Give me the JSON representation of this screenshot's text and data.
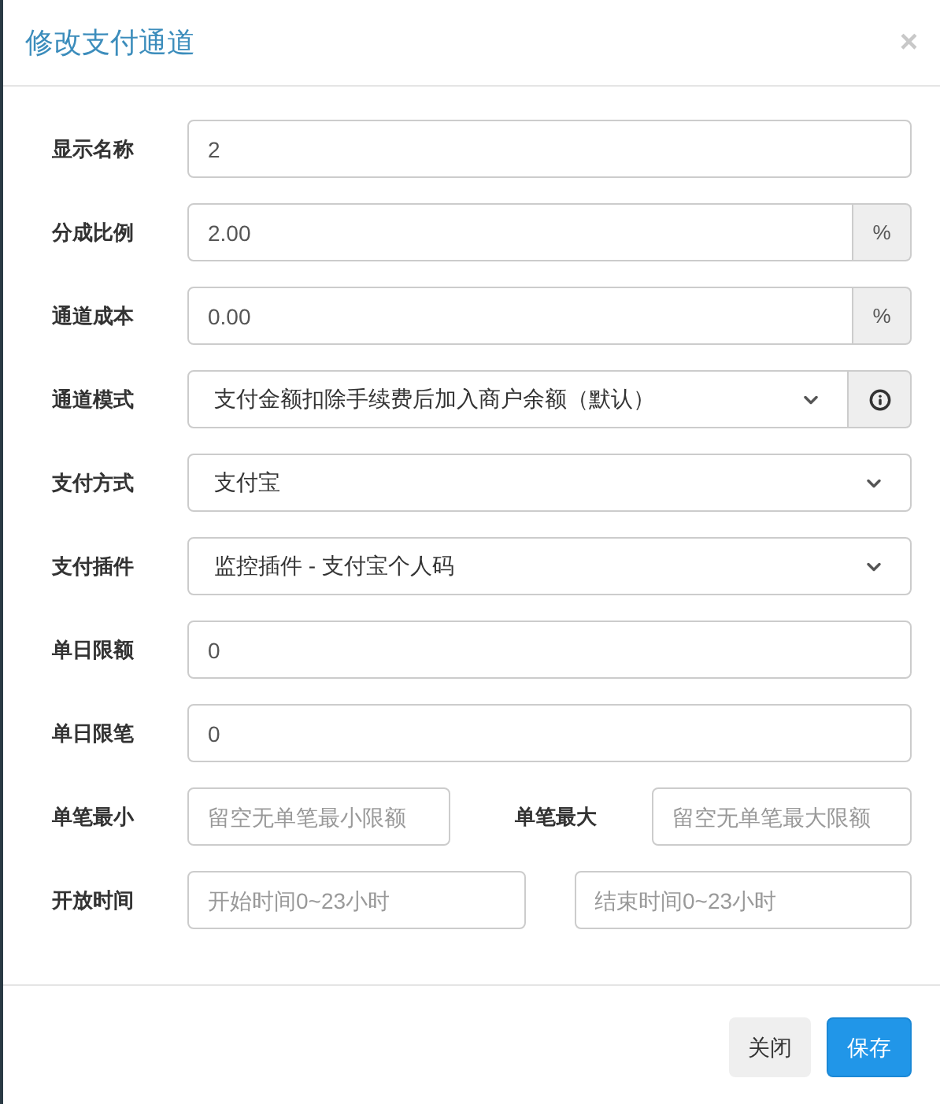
{
  "dialog": {
    "title": "修改支付通道",
    "close": "×"
  },
  "fields": [
    {
      "kind": "text",
      "label": "显示名称",
      "value": "2"
    },
    {
      "kind": "addon",
      "label": "分成比例",
      "value": "2.00",
      "addon": "%"
    },
    {
      "kind": "addon",
      "label": "通道成本",
      "value": "0.00",
      "addon": "%"
    },
    {
      "kind": "select_info",
      "label": "通道模式",
      "value": "支付金额扣除手续费后加入商户余额（默认）"
    },
    {
      "kind": "select",
      "label": "支付方式",
      "value": "支付宝"
    },
    {
      "kind": "select",
      "label": "支付插件",
      "value": "监控插件 - 支付宝个人码"
    },
    {
      "kind": "text",
      "label": "单日限额",
      "value": "0"
    },
    {
      "kind": "text",
      "label": "单日限笔",
      "value": "0"
    },
    {
      "kind": "pair",
      "label": "单笔最小",
      "placeholder": "留空无单笔最小限额",
      "label2": "单笔最大",
      "placeholder2": "留空无单笔最大限额"
    },
    {
      "kind": "range",
      "label": "开放时间",
      "placeholder": "开始时间0~23小时",
      "placeholder2": "结束时间0~23小时"
    }
  ],
  "buttons": [
    {
      "label": "关闭",
      "kind": "default"
    },
    {
      "label": "保存",
      "kind": "primary"
    }
  ]
}
